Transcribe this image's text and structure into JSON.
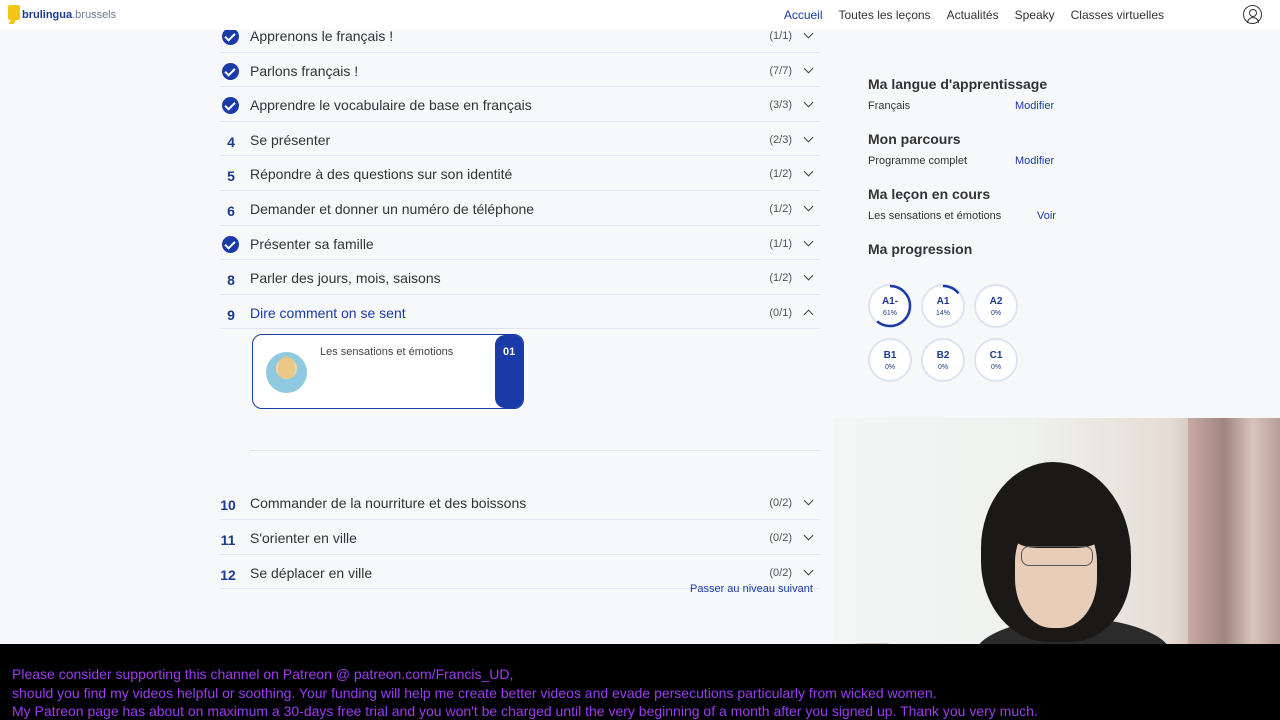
{
  "header": {
    "logo_main": "brulingua",
    "logo_domain": ".brussels",
    "nav": [
      "Accueil",
      "Toutes les leçons",
      "Actualités",
      "Speaky",
      "Classes virtuelles"
    ],
    "active_nav": "Accueil"
  },
  "lessons": [
    {
      "marker": "check",
      "title": "Apprenons le français !",
      "count": "(1/1)",
      "state": "collapsed"
    },
    {
      "marker": "check",
      "title": "Parlons français !",
      "count": "(7/7)",
      "state": "collapsed"
    },
    {
      "marker": "check",
      "title": "Apprendre le vocabulaire de base en français",
      "count": "(3/3)",
      "state": "collapsed"
    },
    {
      "marker": "4",
      "title": "Se présenter",
      "count": "(2/3)",
      "state": "collapsed"
    },
    {
      "marker": "5",
      "title": "Répondre à des questions sur son identité",
      "count": "(1/2)",
      "state": "collapsed"
    },
    {
      "marker": "6",
      "title": "Demander et donner un numéro de téléphone",
      "count": "(1/2)",
      "state": "collapsed"
    },
    {
      "marker": "check",
      "title": "Présenter sa famille",
      "count": "(1/1)",
      "state": "collapsed"
    },
    {
      "marker": "8",
      "title": "Parler des jours, mois, saisons",
      "count": "(1/2)",
      "state": "collapsed"
    },
    {
      "marker": "9",
      "title": "Dire comment on se sent",
      "count": "(0/1)",
      "state": "expanded"
    },
    {
      "marker": "10",
      "title": "Commander de la nourriture et des boissons",
      "count": "(0/2)",
      "state": "collapsed"
    },
    {
      "marker": "11",
      "title": "S'orienter en ville",
      "count": "(0/2)",
      "state": "collapsed"
    },
    {
      "marker": "12",
      "title": "Se déplacer en ville",
      "count": "(0/2)",
      "state": "collapsed"
    }
  ],
  "expanded_card": {
    "title": "Les sensations et émotions",
    "badge": "01"
  },
  "next_level": "Passer au niveau suivant",
  "sidebar": {
    "learning_language": {
      "heading": "Ma langue d'apprentissage",
      "value": "Français",
      "action": "Modifier"
    },
    "path": {
      "heading": "Mon parcours",
      "value": "Programme complet",
      "action": "Modifier"
    },
    "current_lesson": {
      "heading": "Ma leçon en cours",
      "value": "Les sensations et émotions",
      "action": "Voir"
    },
    "progress": {
      "heading": "Ma progression",
      "levels": [
        {
          "label": "A1-",
          "pct_text": "61%",
          "value": 0.61
        },
        {
          "label": "A1",
          "pct_text": "14%",
          "value": 0.14
        },
        {
          "label": "A2",
          "pct_text": "0%",
          "value": 0
        },
        {
          "label": "B1",
          "pct_text": "0%",
          "value": 0
        },
        {
          "label": "B2",
          "pct_text": "0%",
          "value": 0
        },
        {
          "label": "C1",
          "pct_text": "0%",
          "value": 0
        }
      ]
    }
  },
  "banner": {
    "line1": "Please consider supporting this channel on Patreon @ patreon.com/Francis_UD,",
    "line2": "should you find my videos helpful or soothing. Your funding will help me create better videos and evade persecutions particularly from wicked women.",
    "line3": "My Patreon page has about on maximum a 30-days free trial and you won't be charged until the very beginning of a month after you signed up. Thank you very much."
  },
  "colors": {
    "brand_blue": "#1a3aa8",
    "banner_text": "#9b3cf0",
    "logo_yellow": "#f5c518"
  },
  "icons": [
    "check-icon",
    "chevron-down-icon",
    "chevron-up-icon",
    "account-icon"
  ]
}
